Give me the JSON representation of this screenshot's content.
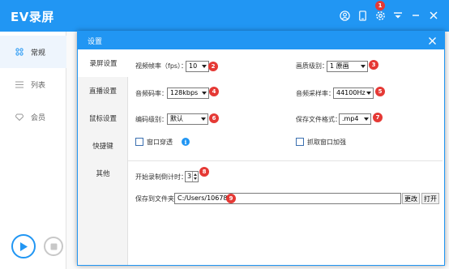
{
  "app": {
    "title": "EV录屏"
  },
  "titlebar": {
    "badge": "1"
  },
  "sidebar": {
    "items": [
      {
        "label": "常规"
      },
      {
        "label": "列表"
      },
      {
        "label": "会员"
      }
    ]
  },
  "dialog": {
    "title": "设置",
    "nav": [
      {
        "label": "录屏设置"
      },
      {
        "label": "直播设置"
      },
      {
        "label": "鼠标设置"
      },
      {
        "label": "快捷键"
      },
      {
        "label": "其他"
      }
    ],
    "video_fps": {
      "label": "视频帧率（fps）：",
      "value": "10",
      "marker": "2"
    },
    "quality": {
      "label": "画质级别：",
      "value": "1 原画",
      "marker": "3"
    },
    "audio_bitrate": {
      "label": "音频码率：",
      "value": "128kbps",
      "marker": "4"
    },
    "sample_rate": {
      "label": "音频采样率：",
      "value": "44100Hz",
      "marker": "5"
    },
    "encode_level": {
      "label": "编码级别：",
      "value": "默认",
      "marker": "6"
    },
    "file_format": {
      "label": "保存文件格式：",
      "value": ".mp4",
      "marker": "7"
    },
    "window_pass": {
      "label": "窗口穿透"
    },
    "capture_enhance": {
      "label": "抓取窗口加强"
    },
    "countdown": {
      "label": "开始录制倒计时：",
      "value": "3",
      "marker": "8"
    },
    "save_folder": {
      "label": "保存到文件夹：",
      "value": "C:/Users/10678",
      "marker": "9",
      "change_label": "更改",
      "open_label": "打开"
    }
  },
  "colors": {
    "accent": "#2196f3",
    "marker": "#e53935"
  }
}
